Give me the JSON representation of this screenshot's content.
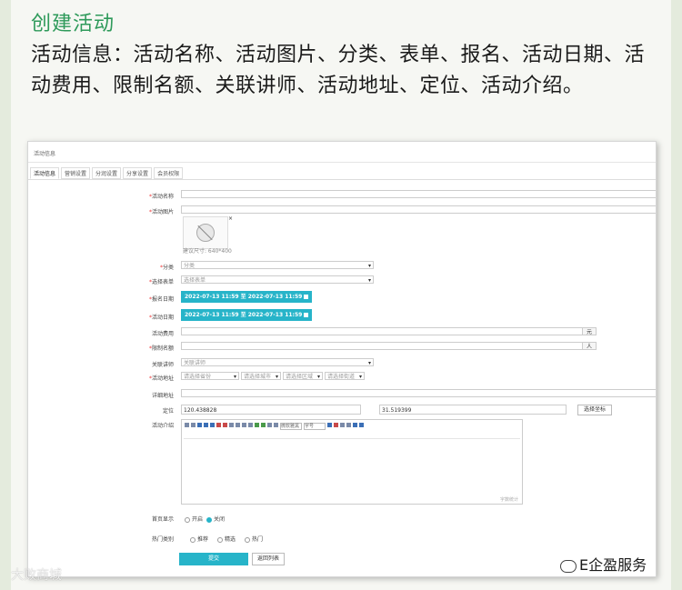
{
  "article": {
    "title": "创建活动",
    "description": "活动信息：活动名称、活动图片、分类、表单、报名、活动日期、活动费用、限制名额、关联讲师、活动地址、定位、活动介绍。"
  },
  "form": {
    "header": "活动信息",
    "tabs": [
      "活动信息",
      "营销设置",
      "分润设置",
      "分享设置",
      "会员权限"
    ],
    "labels": {
      "name": "活动名称",
      "image": "活动图片",
      "category": "分类",
      "form_select": "选择表单",
      "signup_date": "报名日期",
      "activity_date": "活动日期",
      "fee": "活动费用",
      "quota": "限制名额",
      "lecturer": "关联讲师",
      "address": "活动地址",
      "address_detail": "详细地址",
      "location": "定位",
      "intro": "活动介绍",
      "home_display": "首页显示",
      "hot_category": "热门类别"
    },
    "required_mark": "*",
    "image_hint": "建议尺寸: 640*400",
    "image_remove": "×",
    "category_placeholder": "分类",
    "form_placeholder": "选择表单",
    "signup_range": "2022-07-13 11:59 至 2022-07-13 11:59",
    "activity_range": "2022-07-13 11:59 至 2022-07-13 11:59",
    "fee_unit": "元",
    "quota_unit": "人",
    "lecturer_placeholder": "关联讲师",
    "address_selects": [
      "请选择省份",
      "请选择城市",
      "请选择区域",
      "请选择街道"
    ],
    "longitude": "120.438828",
    "latitude": "31.519399",
    "coord_button": "选择坐标",
    "editor_font": "微软雅黑",
    "editor_size": "字号",
    "word_count": "字数统计",
    "home_display_options": [
      "开启",
      "关闭"
    ],
    "home_display_selected": "关闭",
    "hot_options": [
      "推荐",
      "精选",
      "热门"
    ],
    "submit": "提交",
    "back": "返回列表"
  },
  "watermark": {
    "left": "大败商城",
    "right": "E企盈服务"
  }
}
